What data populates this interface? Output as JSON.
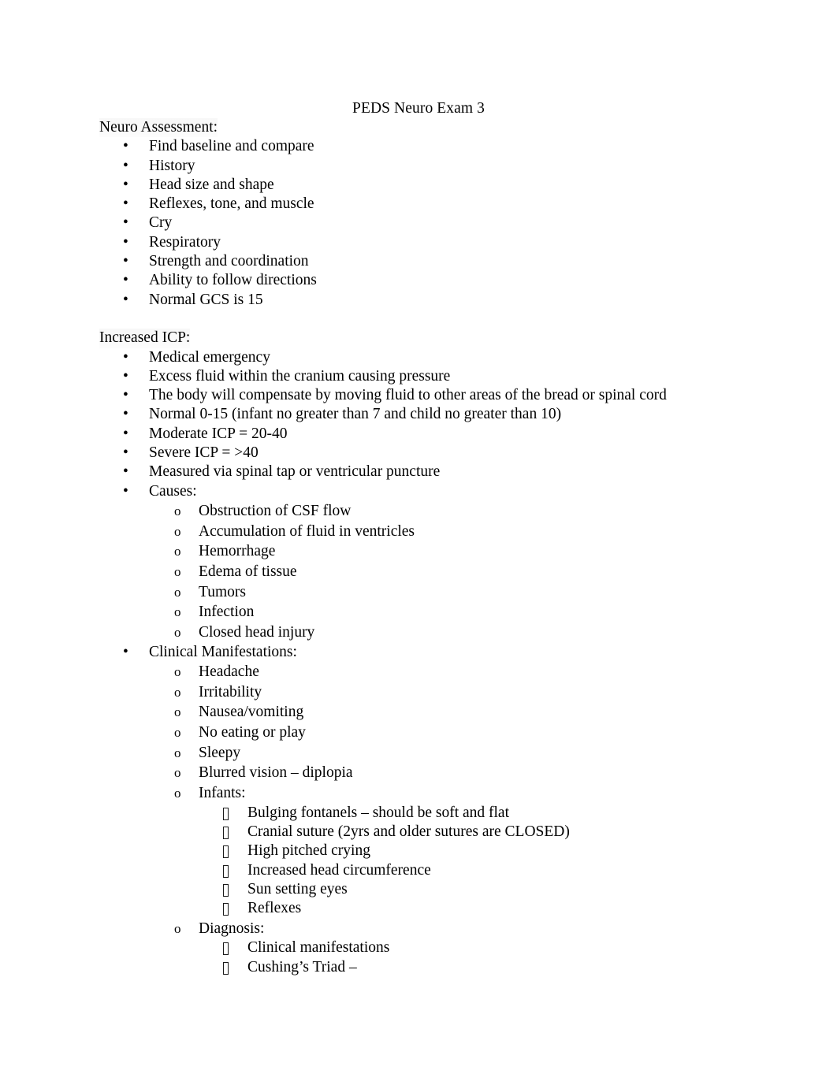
{
  "document": {
    "title": "PEDS Neuro Exam 3",
    "page_background": "#ffffff",
    "text_color": "#000000"
  },
  "sections": [
    {
      "heading": "Neuro Assessment:",
      "items": [
        {
          "level": 1,
          "marker": "bullet",
          "text": "Find baseline and compare"
        },
        {
          "level": 1,
          "marker": "bullet",
          "text": "History"
        },
        {
          "level": 1,
          "marker": "bullet",
          "text": "Head size and shape"
        },
        {
          "level": 1,
          "marker": "bullet",
          "text": "Reflexes, tone, and muscle"
        },
        {
          "level": 1,
          "marker": "bullet",
          "text": "Cry"
        },
        {
          "level": 1,
          "marker": "bullet",
          "text": "Respiratory"
        },
        {
          "level": 1,
          "marker": "bullet",
          "text": "Strength and coordination"
        },
        {
          "level": 1,
          "marker": "bullet",
          "text": "Ability to follow directions"
        },
        {
          "level": 1,
          "marker": "bullet",
          "text": "Normal GCS is 15"
        }
      ]
    },
    {
      "heading": "Increased ICP:",
      "items": [
        {
          "level": 1,
          "marker": "bullet",
          "text": "Medical emergency"
        },
        {
          "level": 1,
          "marker": "bullet",
          "text": "Excess fluid within the cranium causing pressure"
        },
        {
          "level": 1,
          "marker": "bullet",
          "text": "The body will compensate by moving fluid to other areas of the bread or spinal cord"
        },
        {
          "level": 1,
          "marker": "bullet",
          "text": "Normal 0-15 (infant no greater than 7 and child no greater than 10)"
        },
        {
          "level": 1,
          "marker": "bullet",
          "text": "Moderate ICP = 20-40"
        },
        {
          "level": 1,
          "marker": "bullet",
          "text": "Severe ICP = >40"
        },
        {
          "level": 1,
          "marker": "bullet",
          "text": "Measured via spinal tap or ventricular puncture"
        },
        {
          "level": 1,
          "marker": "bullet",
          "text": "Causes:"
        },
        {
          "level": 2,
          "marker": "o",
          "text": "Obstruction of CSF flow"
        },
        {
          "level": 2,
          "marker": "o",
          "text": "Accumulation of fluid in ventricles"
        },
        {
          "level": 2,
          "marker": "o",
          "text": "Hemorrhage"
        },
        {
          "level": 2,
          "marker": "o",
          "text": "Edema of tissue"
        },
        {
          "level": 2,
          "marker": "o",
          "text": "Tumors"
        },
        {
          "level": 2,
          "marker": "o",
          "text": "Infection"
        },
        {
          "level": 2,
          "marker": "o",
          "text": "Closed head injury"
        },
        {
          "level": 1,
          "marker": "bullet",
          "text": "Clinical Manifestations:"
        },
        {
          "level": 2,
          "marker": "o",
          "text": "Headache"
        },
        {
          "level": 2,
          "marker": "o",
          "text": "Irritability"
        },
        {
          "level": 2,
          "marker": "o",
          "text": "Nausea/vomiting"
        },
        {
          "level": 2,
          "marker": "o",
          "text": "No eating or play"
        },
        {
          "level": 2,
          "marker": "o",
          "text": "Sleepy"
        },
        {
          "level": 2,
          "marker": "o",
          "text": "Blurred vision – diplopia"
        },
        {
          "level": 2,
          "marker": "o",
          "text": "Infants:"
        },
        {
          "level": 3,
          "marker": "box",
          "text": "Bulging fontanels – should be soft and flat"
        },
        {
          "level": 3,
          "marker": "box",
          "text": "Cranial suture (2yrs and older sutures are CLOSED)"
        },
        {
          "level": 3,
          "marker": "box",
          "text": "High pitched crying"
        },
        {
          "level": 3,
          "marker": "box",
          "text": "Increased head circumference"
        },
        {
          "level": 3,
          "marker": "box",
          "text": "Sun setting eyes"
        },
        {
          "level": 3,
          "marker": "box",
          "text": "Reflexes"
        },
        {
          "level": 2,
          "marker": "o",
          "text": "Diagnosis:"
        },
        {
          "level": 3,
          "marker": "box",
          "text": "Clinical manifestations"
        },
        {
          "level": 3,
          "marker": "box",
          "text": "Cushing’s Triad –"
        }
      ]
    }
  ],
  "markers": {
    "bullet": "•",
    "o": "o",
    "box": ""
  }
}
